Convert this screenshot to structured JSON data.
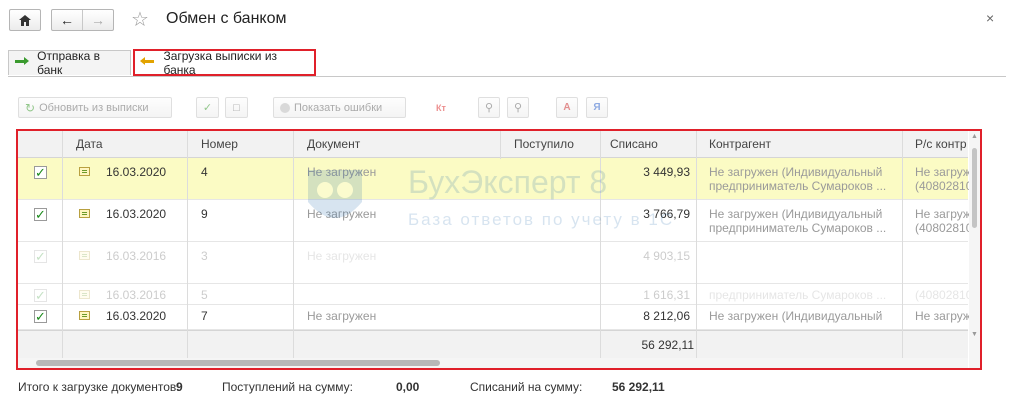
{
  "header": {
    "title": "Обмен с банком",
    "close_glyph": "×"
  },
  "tabs": [
    {
      "label": "Отправка в банк",
      "icon": "send-arrow-icon"
    },
    {
      "label": "Загрузка выписки из банка",
      "icon": "load-arrow-icon",
      "active": true
    }
  ],
  "toolbar": {
    "refresh_label": "Обновить из выписки",
    "errors_label": "Показать ошибки",
    "kt_label": "Кт",
    "sort_az_label": "А",
    "sort_za_label": "Я"
  },
  "table": {
    "columns": [
      "Дата",
      "Номер",
      "Документ",
      "Поступило",
      "Списано",
      "Контрагент",
      "Р/с контр"
    ],
    "rows": [
      {
        "checked": true,
        "date": "16.03.2020",
        "number": "4",
        "document": "Не загружен",
        "received": "",
        "debited": "3 449,93",
        "contragent1": "Не загружен (Индивидуальный",
        "contragent2": "предприниматель Сумароков ...",
        "account1": "Не загруж",
        "account2": "(40802810",
        "selected": true
      },
      {
        "checked": true,
        "date": "16.03.2020",
        "number": "9",
        "document": "Не загружен",
        "received": "",
        "debited": "3 766,79",
        "contragent1": "Не загружен (Индивидуальный",
        "contragent2": "предприниматель Сумароков ...",
        "account1": "Не загруж",
        "account2": "(40802810"
      },
      {
        "checked": true,
        "date": "16.03.2016",
        "number": "3",
        "document": "Не загружен",
        "received": "",
        "debited": "4 903,15",
        "contragent1": "",
        "contragent2": "",
        "account1": "",
        "account2": "",
        "faded": true
      },
      {
        "checked": true,
        "date": "16.03.2016",
        "number": "5",
        "document": "",
        "received": "",
        "debited": "1 616,31",
        "contragent1": "",
        "contragent2": "предприниматель Сумароков ...",
        "account1": "",
        "account2": "(40802810",
        "faded": true
      },
      {
        "checked": true,
        "date": "16.03.2020",
        "number": "7",
        "document": "Не загружен",
        "received": "",
        "debited": "8 212,06",
        "contragent1": "Не загружен (Индивидуальный",
        "contragent2": "",
        "account1": "Не загруж",
        "account2": ""
      }
    ],
    "footer_total": "56 292,11"
  },
  "watermark": {
    "line1": "БухЭксперт 8",
    "line2": "База ответов по учету в 1С"
  },
  "totals": {
    "docs_label": "Итого к загрузке документов:",
    "docs_value": "9",
    "received_label": "Поступлений на сумму:",
    "received_value": "0,00",
    "debited_label": "Списаний на сумму:",
    "debited_value": "56 292,11"
  },
  "colors": {
    "accent_red": "#e0202a",
    "selected_row": "#fbfbc4",
    "check_green": "#1a8a1a"
  }
}
